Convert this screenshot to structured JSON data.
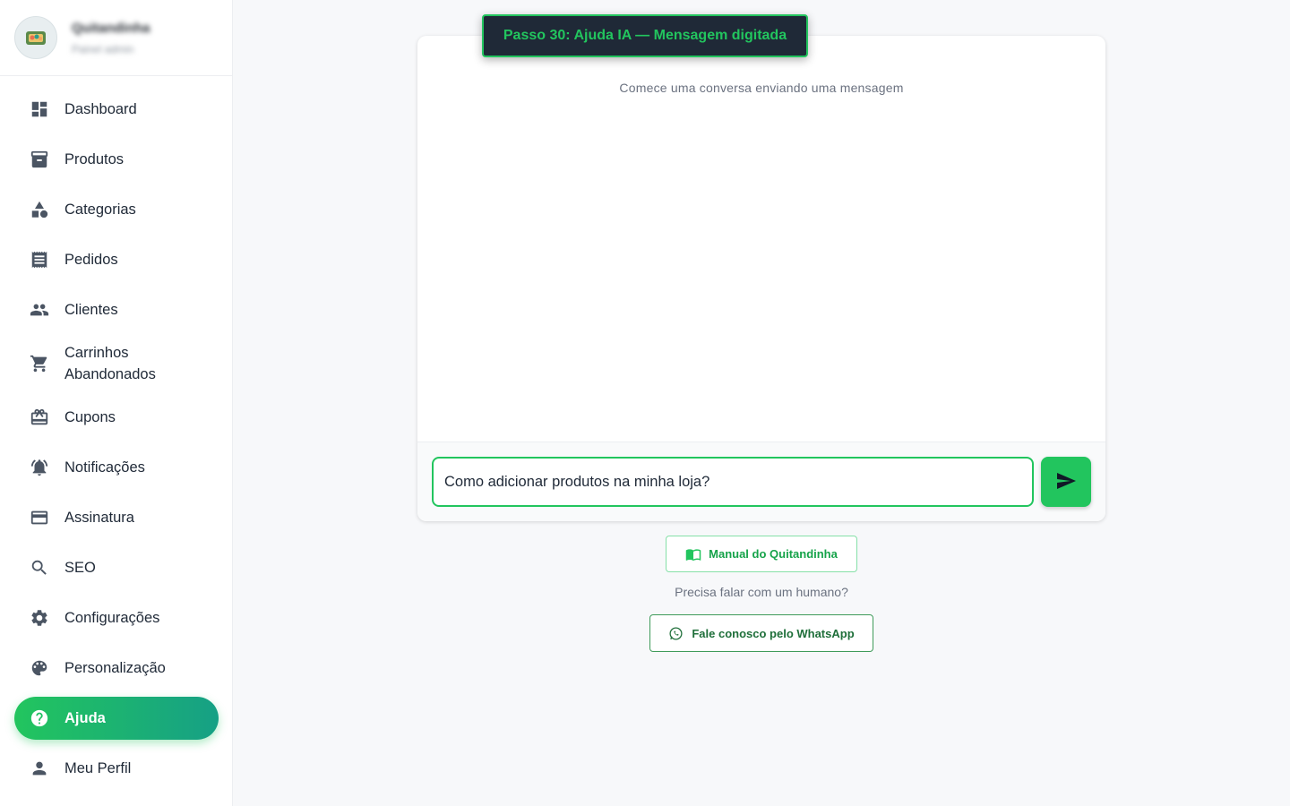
{
  "store": {
    "name": "Quitandinha",
    "subtitle": "Painel admin"
  },
  "nav": {
    "items": [
      {
        "label": "Dashboard",
        "icon": "dashboard-icon"
      },
      {
        "label": "Produtos",
        "icon": "archive-icon"
      },
      {
        "label": "Categorias",
        "icon": "category-icon"
      },
      {
        "label": "Pedidos",
        "icon": "receipt-icon"
      },
      {
        "label": "Clientes",
        "icon": "people-icon"
      },
      {
        "label_line1": "Carrinhos",
        "label_line2": "Abandonados",
        "icon": "cart-icon"
      },
      {
        "label": "Cupons",
        "icon": "coupon-icon"
      },
      {
        "label": "Notificações",
        "icon": "bell-icon"
      },
      {
        "label": "Assinatura",
        "icon": "credit-card-icon"
      },
      {
        "label": "SEO",
        "icon": "search-icon"
      },
      {
        "label": "Configurações",
        "icon": "gear-icon"
      },
      {
        "label": "Personalização",
        "icon": "palette-icon"
      },
      {
        "label": "Ajuda",
        "icon": "help-icon",
        "active": true
      },
      {
        "label": "Meu Perfil",
        "icon": "person-icon"
      }
    ]
  },
  "step_badge": "Passo 30: Ajuda IA — Mensagem digitada",
  "chat": {
    "empty_message": "Comece uma conversa enviando uma mensagem",
    "input_value": "Como adicionar produtos na minha loja?"
  },
  "help": {
    "manual_label": "Manual do Quitandinha",
    "human_text": "Precisa falar com um humano?",
    "whatsapp_label": "Fale conosco pelo WhatsApp"
  },
  "colors": {
    "accent": "#22c55e",
    "accent_dark": "#16a085",
    "badge_bg": "#1f2937"
  }
}
